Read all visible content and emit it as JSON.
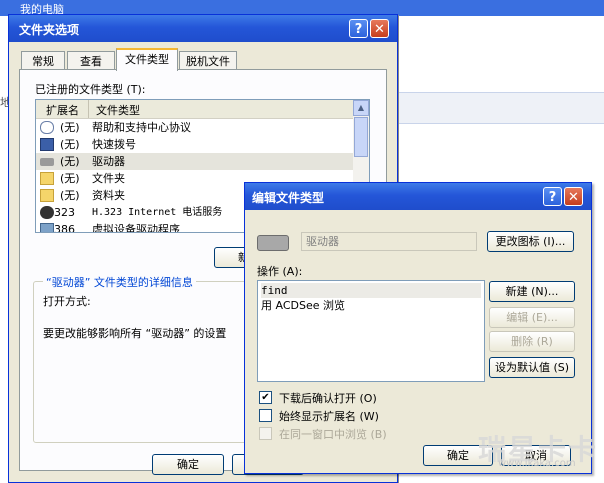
{
  "background": {
    "title": "我的电脑",
    "colors": {
      "titlebar": "#3a6fe0"
    }
  },
  "folder_options": {
    "title": "文件夹选项",
    "tabs": [
      {
        "label": "常规"
      },
      {
        "label": "查看"
      },
      {
        "label": "文件类型"
      },
      {
        "label": "脱机文件"
      }
    ],
    "registered_label": "已注册的文件类型 (T):",
    "columns": {
      "ext": "扩展名",
      "type": "文件类型"
    },
    "rows": [
      {
        "ext": "(无)",
        "type": "帮助和支持中心协议",
        "icon": "help-protocol-icon"
      },
      {
        "ext": "(无)",
        "type": "快速拨号",
        "icon": "speed-dial-icon"
      },
      {
        "ext": "(无)",
        "type": "驱动器",
        "icon": "drive-icon",
        "selected": true
      },
      {
        "ext": "(无)",
        "type": "文件夹",
        "icon": "folder-icon"
      },
      {
        "ext": "(无)",
        "type": "资料夹",
        "icon": "folder-icon"
      },
      {
        "ext": "323",
        "type": "H.323 Internet 电话服务",
        "icon": "phone-service-icon"
      },
      {
        "ext": "386",
        "type": "虚拟设备驱动程序",
        "icon": "driver-icon"
      }
    ],
    "new_button": "新建",
    "details_title": "“驱动器” 文件类型的详细信息",
    "open_with_label": "打开方式:",
    "change_text": "要更改能够影响所有 “驱动器” 的设置",
    "ok_button": "确定"
  },
  "edit_dialog": {
    "title": "编辑文件类型",
    "type_name": "驱动器",
    "change_icon_button": "更改图标 (I)...",
    "actions_label": "操作 (A):",
    "actions": [
      "find",
      "用 ACDSee 浏览"
    ],
    "new_button": "新建 (N)...",
    "edit_button": "编辑 (E)...",
    "delete_button": "删除 (R)",
    "default_button": "设为默认值 (S)",
    "confirm_open_label": "下载后确认打开 (O)",
    "confirm_open_checked": true,
    "always_show_ext_label": "始终显示扩展名 (W)",
    "always_show_ext_checked": false,
    "browse_same_window_label": "在同一窗口中浏览 (B)",
    "browse_same_window_checked": false,
    "ok_button": "确定",
    "cancel_button": "取消"
  },
  "watermark": {
    "text": "瑞星卡卡",
    "url": "www.ikaka.com"
  }
}
